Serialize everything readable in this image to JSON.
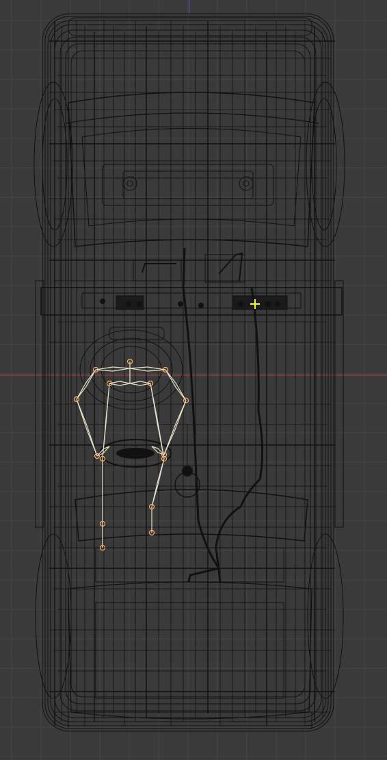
{
  "viewport": {
    "background": "#3a3a3a",
    "grid_color": "#454545",
    "wire_color": "#111111",
    "bone_color": "#e6e0c8",
    "joint_color": "#ffb060",
    "axis_x_color": "#b04040",
    "axis_y_color": "#5050c0",
    "cursor_color": "#ffff00"
  },
  "objects": {
    "car_mesh": "car-wireframe",
    "armature": "driver-skeleton",
    "cursor": "3d-cursor"
  }
}
